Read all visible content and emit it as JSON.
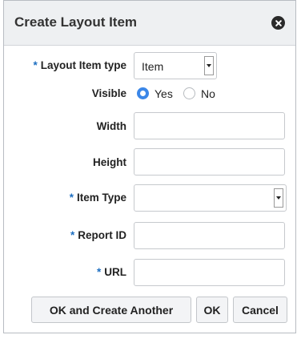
{
  "dialog": {
    "title": "Create Layout Item"
  },
  "fields": {
    "layout_item_type": {
      "label": "Layout Item type",
      "value": "Item",
      "required": true
    },
    "visible": {
      "label": "Visible",
      "options": [
        "Yes",
        "No"
      ],
      "selected": "Yes"
    },
    "width": {
      "label": "Width",
      "value": ""
    },
    "height": {
      "label": "Height",
      "value": ""
    },
    "item_type": {
      "label": "Item Type",
      "value": "",
      "required": true
    },
    "report_id": {
      "label": "Report ID",
      "value": "",
      "required": true
    },
    "url": {
      "label": "URL",
      "value": "",
      "required": true
    }
  },
  "required_marker": "*",
  "buttons": {
    "ok_create_another": "OK and Create Another",
    "ok": "OK",
    "cancel": "Cancel"
  },
  "colors": {
    "accent": "#3b87e8",
    "required_marker": "#1e6fc1",
    "titlebar_bg": "#eef0f2"
  }
}
